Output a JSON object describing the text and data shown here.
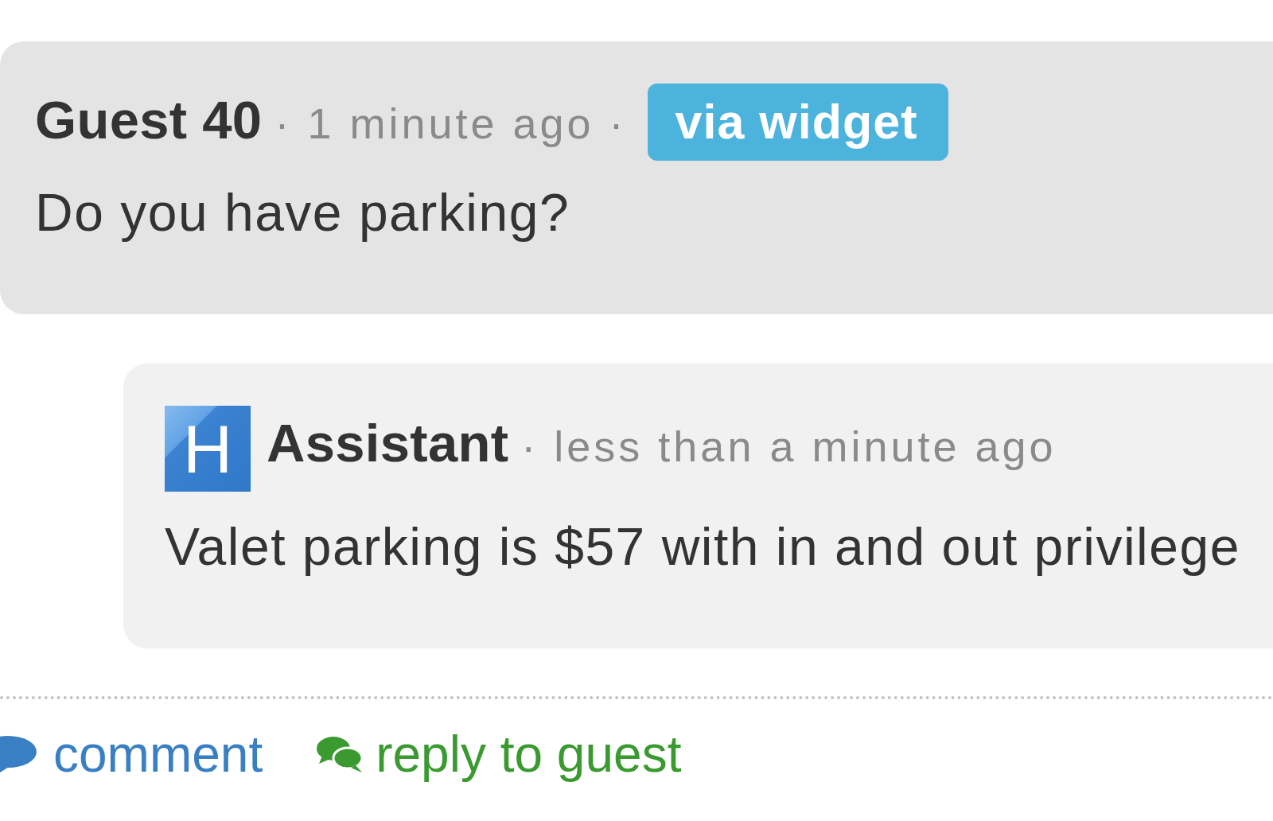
{
  "comment": {
    "author": "Guest 40",
    "meta": "· 1 minute ago ·",
    "badge": "via widget",
    "text": "Do you have parking?"
  },
  "reply": {
    "avatar": "H",
    "author": "Assistant",
    "meta": "· less than a minute ago",
    "text": "Valet parking is $57 with in and out privilege"
  },
  "actions": [
    {
      "kind": "comment",
      "label": "comment"
    },
    {
      "kind": "reply",
      "label": "reply to guest"
    }
  ]
}
